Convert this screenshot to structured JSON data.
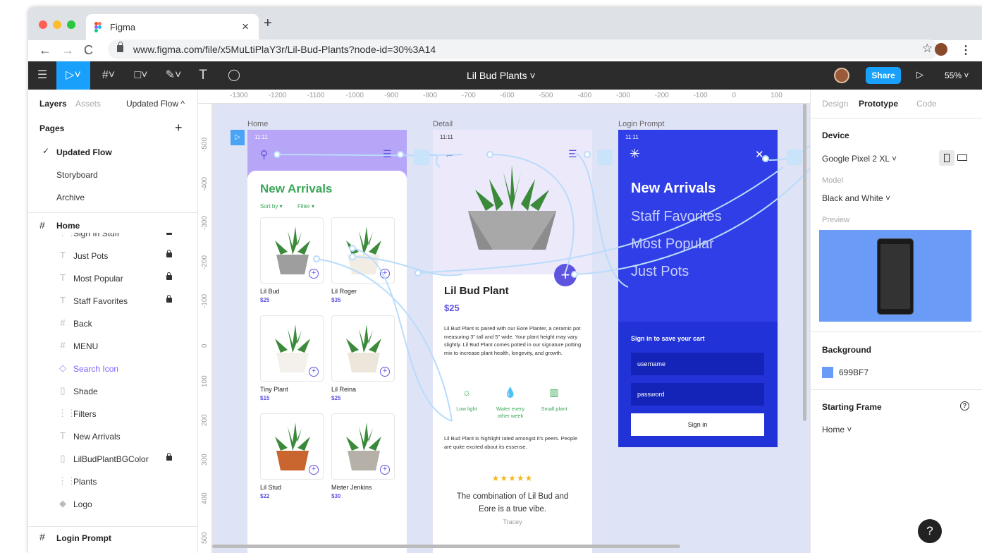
{
  "browser": {
    "tab_title": "Figma",
    "tab_close": "×",
    "new_tab": "+",
    "url": "www.figma.com/file/x5MuLtiPlaY3r/Lil-Bud-Plants?node-id=30%3A14",
    "back": "←",
    "forward": "→",
    "reload": "C",
    "bookmark": "☆",
    "menu": "⋮",
    "dot_colors": [
      "#ff5f57",
      "#febc2e",
      "#28c840"
    ]
  },
  "toolbar": {
    "menu_icon": "☰",
    "move_tool": "▷˅",
    "frame_tool": "#˅",
    "shape_tool": "□˅",
    "pen_tool": "✎˅",
    "text_tool": "T",
    "comment_tool": "◯",
    "doc_name": "Lil Bud Plants ˅",
    "share_label": "Share",
    "present": "▷",
    "zoom": "55% ˅"
  },
  "left_panel": {
    "tabs": {
      "layers": "Layers",
      "assets": "Assets",
      "page": "Updated Flow ^"
    },
    "pages_title": "Pages",
    "add_page": "+",
    "pages": [
      {
        "label": "Updated Flow",
        "check": "✓"
      },
      {
        "label": "Storyboard",
        "check": ""
      },
      {
        "label": "Archive",
        "check": ""
      }
    ],
    "home_frame": "Home",
    "layers": [
      {
        "icon": "⋮⋮",
        "label": "Sign In Stuff",
        "locked": true
      },
      {
        "icon": "T",
        "label": "Just Pots",
        "locked": true
      },
      {
        "icon": "T",
        "label": "Most Popular",
        "locked": true
      },
      {
        "icon": "T",
        "label": "Staff Favorites",
        "locked": true
      },
      {
        "icon": "#",
        "label": "Back",
        "locked": false
      },
      {
        "icon": "#",
        "label": "MENU",
        "locked": false
      },
      {
        "icon": "◇",
        "label": "Search Icon",
        "locked": false
      },
      {
        "icon": "▯",
        "label": "Shade",
        "locked": false
      },
      {
        "icon": "⋮⋮",
        "label": "Filters",
        "locked": false
      },
      {
        "icon": "T",
        "label": "New Arrivals",
        "locked": false
      },
      {
        "icon": "▯",
        "label": "LilBudPlantBGColor",
        "locked": true
      },
      {
        "icon": "⋮⋮",
        "label": "Plants",
        "locked": false
      },
      {
        "icon": "◆",
        "label": "Logo",
        "locked": false
      }
    ],
    "login_frame": "Login Prompt",
    "hash": "#"
  },
  "canvas": {
    "ruler_x": [
      "-1300",
      "-1200",
      "-1100",
      "-1000",
      "-900",
      "-800",
      "-700",
      "-600",
      "-500",
      "-400",
      "-300",
      "-200",
      "-100",
      "0",
      "100"
    ],
    "ruler_y": [
      "-500",
      "-400",
      "-300",
      "-200",
      "-100",
      "0",
      "100",
      "200",
      "300",
      "400",
      "500"
    ],
    "home": {
      "label": "Home",
      "time": "11:11",
      "heading": "New Arrivals",
      "sort": "Sort by ▾",
      "filter": "Filter ▾",
      "plants": [
        {
          "name": "Lil Bud",
          "price": "$25"
        },
        {
          "name": "Lil Roger",
          "price": "$35"
        },
        {
          "name": "Tiny Plant",
          "price": "$15"
        },
        {
          "name": "Lil Reina",
          "price": "$25"
        },
        {
          "name": "Lil Stud",
          "price": "$22"
        },
        {
          "name": "Mister Jenkins",
          "price": "$30"
        }
      ]
    },
    "detail": {
      "label": "Detail",
      "time": "11:11",
      "title": "Lil Bud Plant",
      "price": "$25",
      "description": "Lil Bud Plant is paired with our Eore Planter, a ceramic pot measuring 3\" tall and 5\" wide. Your plant height may vary slightly. Lil Bud Plant comes potted in our signature potting mix to increase plant health, longevity, and growth.",
      "care": [
        "Low light",
        "Water every other week",
        "Small plant"
      ],
      "review_intro": "Lil Bud Plant is highlight rated amongst it's peers. People are quite excited about its essense.",
      "stars": "★★★★★",
      "quote": "The combination of Lil Bud and Eore is a true vibe.",
      "author": "Tracey"
    },
    "login": {
      "label": "Login Prompt",
      "time": "11:11",
      "menu": [
        "New Arrivals",
        "Staff Favorites",
        "Most Popular",
        "Just Pots"
      ],
      "sign_in_title": "Sign in to save your cart",
      "username": "username",
      "password": "password",
      "button": "Sign in"
    }
  },
  "right_panel": {
    "tabs": {
      "design": "Design",
      "prototype": "Prototype",
      "code": "Code"
    },
    "device_title": "Device",
    "device": "Google Pixel 2 XL ˅",
    "model_label": "Model",
    "model": "Black and White ˅",
    "preview_label": "Preview",
    "background_title": "Background",
    "background_color": "699BF7",
    "starting_frame_title": "Starting Frame",
    "starting_frame": "Home ˅",
    "help": "?"
  },
  "colors": {
    "accent": "#18a0fb",
    "brand_purple": "#5f54e0",
    "login_blue": "#2f3ee6",
    "preview_bg": "#699BF7",
    "green": "#3aa657"
  }
}
